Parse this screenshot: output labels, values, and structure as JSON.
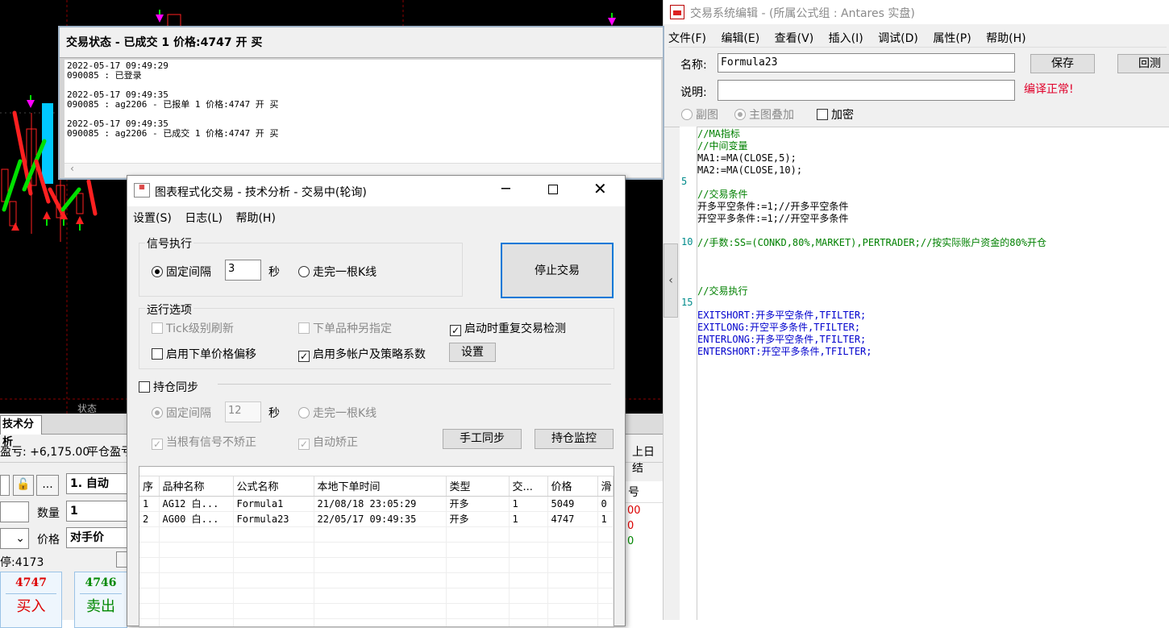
{
  "chart": {
    "status_label": "状态"
  },
  "log_window": {
    "title": "交易状态 - 已成交 1 价格:4747 开 买",
    "lines": [
      "2022-05-17 09:49:29",
      "090085 : 已登录",
      "",
      "2022-05-17 09:49:35",
      "090085 : ag2206 - 已报单 1 价格:4747 开 买",
      "",
      "2022-05-17 09:49:35",
      "090085 : ag2206 - 已成交 1 价格:4747 开 买"
    ]
  },
  "bottom_panel": {
    "tab": "技术分析",
    "pnl_text": "盈亏: +6,175.00",
    "close_pnl_label": "平仓盈亏",
    "prev_label": "上日结",
    "mode_value": "1. 自动",
    "more_label": "...",
    "qty_label": "数量",
    "qty_value": "1",
    "price_label": "价格",
    "price_value": "对手价",
    "limit_text": "停:4173",
    "buy_price": "4747",
    "buy_label": "买入",
    "sell_price": "4746",
    "sell_label": "卖出",
    "right_col_header": "号",
    "right_vals": [
      "00",
      "0",
      "0"
    ]
  },
  "editor": {
    "title": "交易系统编辑 - (所属公式组 : Antares 实盘)",
    "menu": [
      "文件(F)",
      "编辑(E)",
      "查看(V)",
      "插入(I)",
      "调试(D)",
      "属性(P)",
      "帮助(H)"
    ],
    "name_label": "名称:",
    "name_value": "Formula23",
    "save_button": "保存",
    "backtest_button": "回测",
    "desc_label": "说明:",
    "compile_status": "编译正常!",
    "sub_chart": "副图",
    "main_overlay": "主图叠加",
    "encrypt": "加密",
    "line_numbers": [
      "5",
      "10",
      "15"
    ],
    "code": [
      "//MA指标",
      "//中间变量",
      "MA1:=MA(CLOSE,5);",
      "MA2:=MA(CLOSE,10);",
      "",
      "//交易条件",
      "开多平空条件:=1;//开多平空条件",
      "开空平多条件:=1;//开空平多条件",
      "",
      "//手数:SS=(CONKD,80%,MARKET),PERTRADER;//按实际账户资金的80%开仓",
      "",
      "",
      "",
      "//交易执行",
      "",
      "EXITSHORT:开多平空条件,TFILTER;",
      "EXITLONG:开空平多条件,TFILTER;",
      "ENTERLONG:开多平空条件,TFILTER;",
      "ENTERSHORT:开空平多条件,TFILTER;"
    ]
  },
  "dialog": {
    "title": "图表程式化交易 - 技术分析 - 交易中(轮询)",
    "menu": [
      "设置(S)",
      "日志(L)",
      "帮助(H)"
    ],
    "signal_group": "信号执行",
    "fixed_interval": "固定间隔",
    "interval_value": "3",
    "seconds": "秒",
    "one_bar": "走完一根K线",
    "stop_button": "停止交易",
    "run_options": "运行选项",
    "tick_refresh": "Tick级别刷新",
    "order_variety": "下单品种另指定",
    "startup_check": "启动时重复交易检测",
    "price_offset": "启用下单价格偏移",
    "multi_account": "启用多帐户及策略系数",
    "settings_button": "设置",
    "position_sync": "持仓同步",
    "sync_fixed": "固定间隔",
    "sync_interval": "12",
    "sync_seconds": "秒",
    "sync_bar": "走完一根K线",
    "no_correct": "当根有信号不矫正",
    "auto_correct": "自动矫正",
    "manual_sync": "手工同步",
    "position_monitor": "持仓监控",
    "table": {
      "headers": [
        "序",
        "品种名称",
        "公式名称",
        "本地下单时间",
        "类型",
        "交...",
        "价格",
        "滑"
      ],
      "rows": [
        [
          "1",
          "AG12 白...",
          "Formula1",
          "21/08/18 23:05:29",
          "开多",
          "1",
          "5049",
          "0"
        ],
        [
          "2",
          "AG00 白...",
          "Formula23",
          "22/05/17 09:49:35",
          "开多",
          "1",
          "4747",
          "1"
        ]
      ]
    }
  },
  "colors": {
    "up": "#ff2020",
    "down": "#00e000",
    "cyan": "#00c8ff",
    "magenta": "#ff00ff"
  }
}
